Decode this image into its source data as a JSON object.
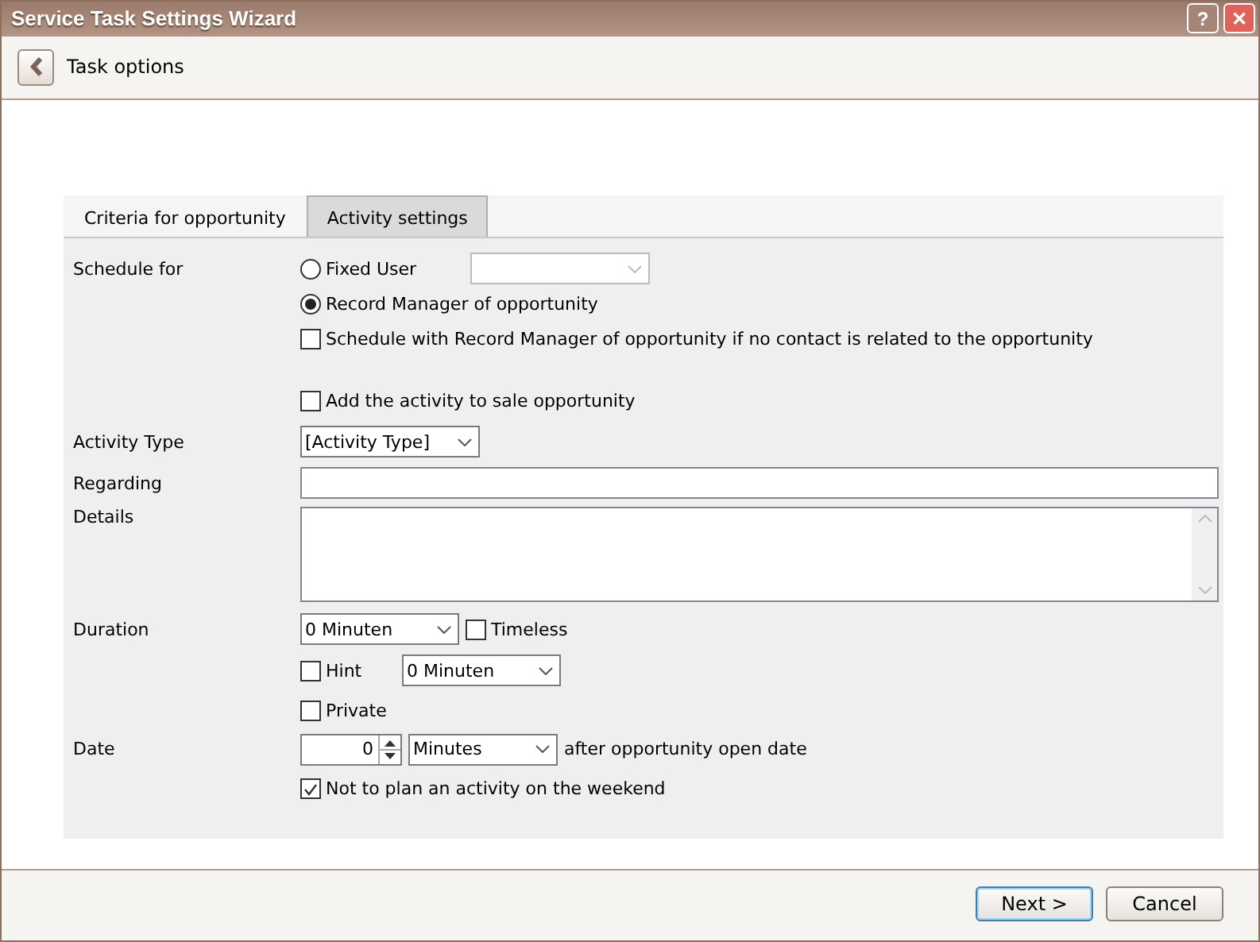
{
  "window": {
    "title": "Service Task Settings Wizard",
    "help_button": "?",
    "close_button": "✕"
  },
  "header": {
    "title": "Task options"
  },
  "tabs": [
    {
      "label": "Criteria for opportunity",
      "selected": false
    },
    {
      "label": "Activity settings",
      "selected": true
    }
  ],
  "schedule_for": {
    "label": "Schedule for",
    "options": [
      {
        "label": "Fixed User",
        "selected": false
      },
      {
        "label": "Record Manager of opportunity",
        "selected": true
      }
    ],
    "fixed_user": {
      "disabled": true
    },
    "fallback": {
      "label": "Schedule with Record Manager of opportunity if no contact is related to the opportunity",
      "checked": false
    }
  },
  "add_to_opportunity": {
    "label": "Add the activity to sale opportunity",
    "checked": false
  },
  "activity_type": {
    "label": "Activity Type",
    "value": "[Activity Type]"
  },
  "regarding": {
    "label": "Regarding"
  },
  "details": {
    "label": "Details"
  },
  "duration": {
    "label": "Duration",
    "value": "0 Minuten",
    "timeless": {
      "label": "Timeless",
      "checked": false
    },
    "hint": {
      "label": "Hint",
      "checked": false,
      "value": "0 Minuten"
    },
    "private": {
      "label": "Private",
      "checked": false
    }
  },
  "date": {
    "label": "Date",
    "amount": "0",
    "unit": "Minutes",
    "suffix": "after opportunity open date",
    "weekend": {
      "label": "Not to plan an activity on the weekend",
      "checked": true
    }
  },
  "buttons": [
    {
      "label": "Next >",
      "default": true
    },
    {
      "label": "Cancel",
      "default": false
    }
  ]
}
